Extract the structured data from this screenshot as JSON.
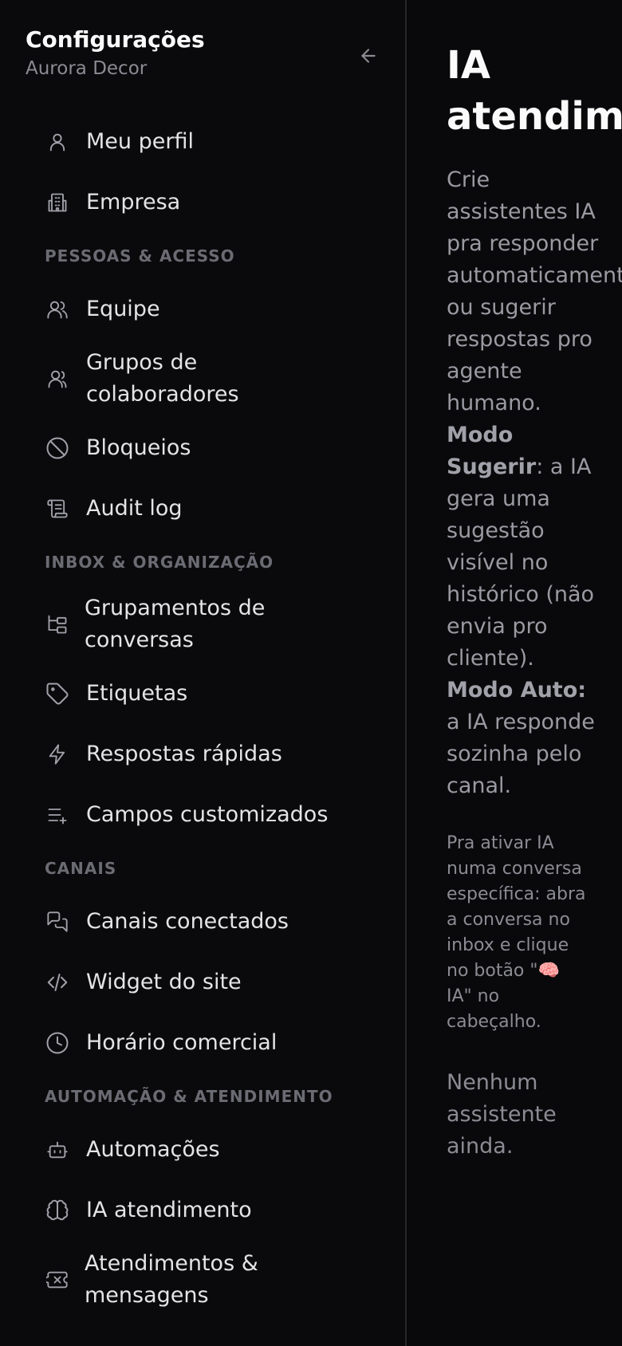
{
  "sidebar": {
    "title": "Configurações",
    "subtitle": "Aurora Decor",
    "back_icon": "arrow-left-icon",
    "items": [
      {
        "label": "Meu perfil",
        "icon": "user-icon"
      },
      {
        "label": "Empresa",
        "icon": "building-icon"
      },
      {
        "section": "PESSOAS & ACESSO"
      },
      {
        "label": "Equipe",
        "icon": "users-icon"
      },
      {
        "label": "Grupos de colaboradores",
        "icon": "user-group-icon"
      },
      {
        "label": "Bloqueios",
        "icon": "ban-icon"
      },
      {
        "label": "Audit log",
        "icon": "scroll-icon"
      },
      {
        "section": "INBOX & ORGANIZAÇÃO"
      },
      {
        "label": "Grupamentos de conversas",
        "icon": "folder-tree-icon"
      },
      {
        "label": "Etiquetas",
        "icon": "tag-icon"
      },
      {
        "label": "Respostas rápidas",
        "icon": "zap-icon"
      },
      {
        "label": "Campos customizados",
        "icon": "list-plus-icon"
      },
      {
        "section": "CANAIS"
      },
      {
        "label": "Canais conectados",
        "icon": "messages-icon"
      },
      {
        "label": "Widget do site",
        "icon": "code-icon"
      },
      {
        "label": "Horário comercial",
        "icon": "clock-icon"
      },
      {
        "section": "AUTOMAÇÃO & ATENDIMENTO"
      },
      {
        "label": "Automações",
        "icon": "bot-icon"
      },
      {
        "label": "IA atendimento",
        "icon": "brain-icon"
      },
      {
        "label": "Atendimentos & mensagens",
        "icon": "ticket-icon"
      }
    ]
  },
  "main": {
    "title": "IA\natendimento",
    "desc_intro": "Crie assistentes IA pra responder automaticamente ou sugerir respostas pro agente humano.",
    "mode_suggest_label": "Modo Sugerir",
    "mode_suggest_text": ": a IA gera uma sugestão visível no histórico (não envia pro cliente).",
    "mode_auto_label": "Modo Auto:",
    "mode_auto_text": " a IA responde sozinha pelo canal.",
    "hint": "Pra ativar IA numa conversa específica: abra a conversa no inbox e clique no botão \"🧠 IA\" no cabeçalho.",
    "empty_state": "Nenhum assistente ainda."
  },
  "colors": {
    "background": "#09090b",
    "text": "#e4e4e7",
    "muted": "#8b8b93",
    "section": "#6b6b73",
    "border": "#27272a"
  }
}
